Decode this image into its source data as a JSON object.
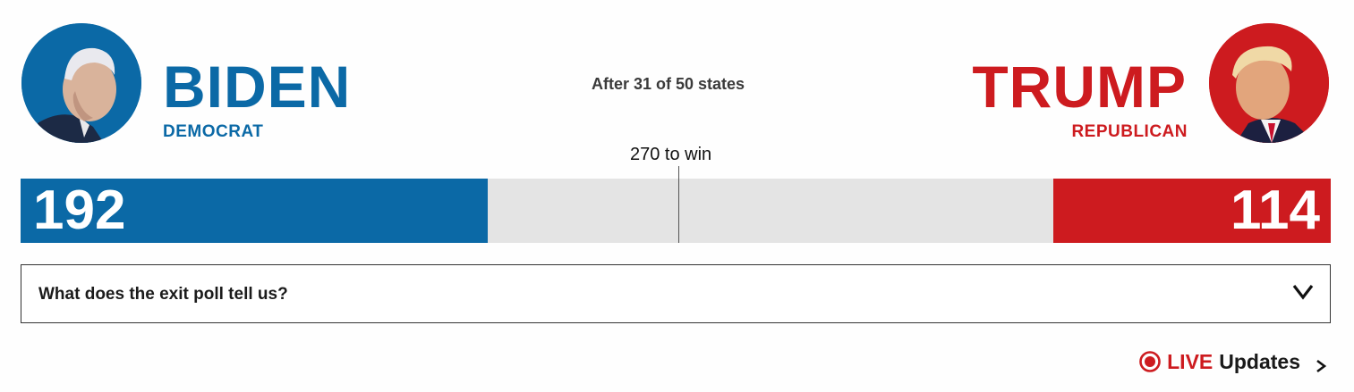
{
  "colors": {
    "democrat": "#0b69a6",
    "republican": "#cd1b1f",
    "neutral": "#e4e4e4"
  },
  "candidates": {
    "biden": {
      "name": "BIDEN",
      "party": "DEMOCRAT",
      "electoral_votes": "192",
      "portrait_icon": "biden-portrait"
    },
    "trump": {
      "name": "TRUMP",
      "party": "REPUBLICAN",
      "electoral_votes": "114",
      "portrait_icon": "trump-portrait"
    }
  },
  "status": "After 31 of 50 states",
  "threshold_label": "270 to win",
  "progress": {
    "total_electoral_votes": 538,
    "threshold": 270,
    "biden": 192,
    "trump": 114
  },
  "exit_poll": {
    "question": "What does the exit poll tell us?",
    "toggle_icon": "chevron-down-icon"
  },
  "live_updates": {
    "live": "LIVE",
    "label": "Updates",
    "icon": "live-indicator-icon",
    "arrow_icon": "chevron-right-icon"
  }
}
